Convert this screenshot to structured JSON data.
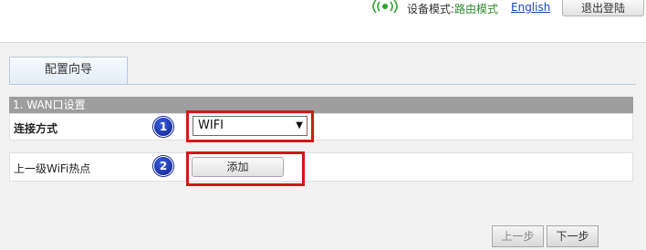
{
  "header": {
    "device_mode_label": "设备模式:",
    "device_mode_value": "路由模式",
    "language_link": "English",
    "logout_label": "退出登陆"
  },
  "tabs": [
    {
      "label": "配置向导"
    }
  ],
  "section": {
    "title": "1. WAN口设置"
  },
  "form": {
    "connection_label": "连接方式",
    "connection_value": "WIFI",
    "upper_wifi_label": "上一级WiFi热点",
    "add_button": "添加"
  },
  "badges": [
    "1",
    "2"
  ],
  "footer": {
    "prev_button": "上一步",
    "next_button": "下一步"
  },
  "colors": {
    "section_bar": "#9e9e9e",
    "highlight_box": "#d21818",
    "badge": "#1a3cc0",
    "mode_value": "#2e8b2e",
    "link": "#1a47b8"
  },
  "icons": [
    "wifi-signal-icon",
    "dropdown-arrow-icon"
  ]
}
